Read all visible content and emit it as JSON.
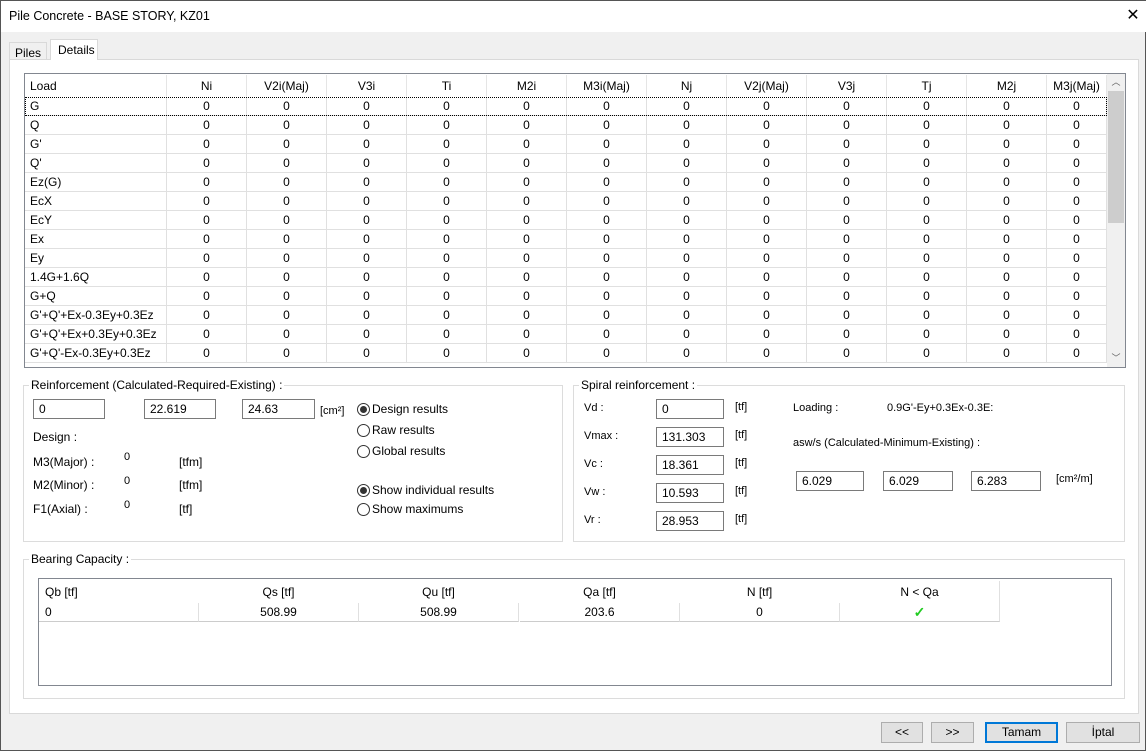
{
  "window": {
    "title": "Pile Concrete - BASE STORY, KZ01",
    "close_icon": "close-icon"
  },
  "tabs": [
    {
      "label": "Piles",
      "selected": false
    },
    {
      "label": "Details",
      "selected": true
    }
  ],
  "grid": {
    "columns": [
      "Load",
      "Ni",
      "V2i(Maj)",
      "V3i",
      "Ti",
      "M2i",
      "M3i(Maj)",
      "Nj",
      "V2j(Maj)",
      "V3j",
      "Tj",
      "M2j",
      "M3j(Maj)"
    ],
    "rows": [
      {
        "load": "G",
        "values": [
          "0",
          "0",
          "0",
          "0",
          "0",
          "0",
          "0",
          "0",
          "0",
          "0",
          "0",
          "0"
        ]
      },
      {
        "load": "Q",
        "values": [
          "0",
          "0",
          "0",
          "0",
          "0",
          "0",
          "0",
          "0",
          "0",
          "0",
          "0",
          "0"
        ]
      },
      {
        "load": "G'",
        "values": [
          "0",
          "0",
          "0",
          "0",
          "0",
          "0",
          "0",
          "0",
          "0",
          "0",
          "0",
          "0"
        ]
      },
      {
        "load": "Q'",
        "values": [
          "0",
          "0",
          "0",
          "0",
          "0",
          "0",
          "0",
          "0",
          "0",
          "0",
          "0",
          "0"
        ]
      },
      {
        "load": "Ez(G)",
        "values": [
          "0",
          "0",
          "0",
          "0",
          "0",
          "0",
          "0",
          "0",
          "0",
          "0",
          "0",
          "0"
        ]
      },
      {
        "load": "EcX",
        "values": [
          "0",
          "0",
          "0",
          "0",
          "0",
          "0",
          "0",
          "0",
          "0",
          "0",
          "0",
          "0"
        ]
      },
      {
        "load": "EcY",
        "values": [
          "0",
          "0",
          "0",
          "0",
          "0",
          "0",
          "0",
          "0",
          "0",
          "0",
          "0",
          "0"
        ]
      },
      {
        "load": "Ex",
        "values": [
          "0",
          "0",
          "0",
          "0",
          "0",
          "0",
          "0",
          "0",
          "0",
          "0",
          "0",
          "0"
        ]
      },
      {
        "load": "Ey",
        "values": [
          "0",
          "0",
          "0",
          "0",
          "0",
          "0",
          "0",
          "0",
          "0",
          "0",
          "0",
          "0"
        ]
      },
      {
        "load": "1.4G+1.6Q",
        "values": [
          "0",
          "0",
          "0",
          "0",
          "0",
          "0",
          "0",
          "0",
          "0",
          "0",
          "0",
          "0"
        ]
      },
      {
        "load": "G+Q",
        "values": [
          "0",
          "0",
          "0",
          "0",
          "0",
          "0",
          "0",
          "0",
          "0",
          "0",
          "0",
          "0"
        ]
      },
      {
        "load": "G'+Q'+Ex-0.3Ey+0.3Ez",
        "values": [
          "0",
          "0",
          "0",
          "0",
          "0",
          "0",
          "0",
          "0",
          "0",
          "0",
          "0",
          "0"
        ]
      },
      {
        "load": "G'+Q'+Ex+0.3Ey+0.3Ez",
        "values": [
          "0",
          "0",
          "0",
          "0",
          "0",
          "0",
          "0",
          "0",
          "0",
          "0",
          "0",
          "0"
        ]
      },
      {
        "load": "G'+Q'-Ex-0.3Ey+0.3Ez",
        "values": [
          "0",
          "0",
          "0",
          "0",
          "0",
          "0",
          "0",
          "0",
          "0",
          "0",
          "0",
          "0"
        ]
      }
    ]
  },
  "reinforcement": {
    "title": "Reinforcement (Calculated-Required-Existing) :",
    "calculated": "0",
    "required": "22.619",
    "existing": "24.63",
    "unit": "[cm²]",
    "design_label": "Design :",
    "m3_label": "M3(Major) :",
    "m3_value": "0",
    "m3_unit": "[tfm]",
    "m2_label": "M2(Minor) :",
    "m2_value": "0",
    "m2_unit": "[tfm]",
    "f1_label": "F1(Axial) :",
    "f1_value": "0",
    "f1_unit": "[tf]",
    "result_options": [
      {
        "label": "Design results",
        "selected": true
      },
      {
        "label": "Raw results",
        "selected": false
      },
      {
        "label": "Global results",
        "selected": false
      }
    ],
    "show_options": [
      {
        "label": "Show individual results",
        "selected": true
      },
      {
        "label": "Show maximums",
        "selected": false
      }
    ]
  },
  "spiral": {
    "title": "Spiral reinforcement :",
    "fields": [
      {
        "label": "Vd :",
        "value": "0",
        "unit": "[tf]"
      },
      {
        "label": "Vmax :",
        "value": "131.303",
        "unit": "[tf]"
      },
      {
        "label": "Vc :",
        "value": "18.361",
        "unit": "[tf]"
      },
      {
        "label": "Vw :",
        "value": "10.593",
        "unit": "[tf]"
      },
      {
        "label": "Vr :",
        "value": "28.953",
        "unit": "[tf]"
      }
    ],
    "loading_label": "Loading :",
    "loading_value": "0.9G'-Ey+0.3Ex-0.3E:",
    "asw_label": "asw/s (Calculated-Minimum-Existing) :",
    "asw_calculated": "6.029",
    "asw_minimum": "6.029",
    "asw_existing": "6.283",
    "asw_unit": "[cm²/m]"
  },
  "bearing": {
    "title": "Bearing Capacity :",
    "columns": [
      "Qb [tf]",
      "Qs [tf]",
      "Qu [tf]",
      "Qa [tf]",
      "N [tf]",
      "N < Qa"
    ],
    "row": [
      "0",
      "508.99",
      "508.99",
      "203.6",
      "0",
      "✓"
    ],
    "check_color": "#22cc22"
  },
  "buttons": {
    "prev": "<<",
    "next": ">>",
    "ok": "Tamam",
    "cancel": "İptal"
  },
  "colors": {
    "accent": "#0078d7"
  }
}
